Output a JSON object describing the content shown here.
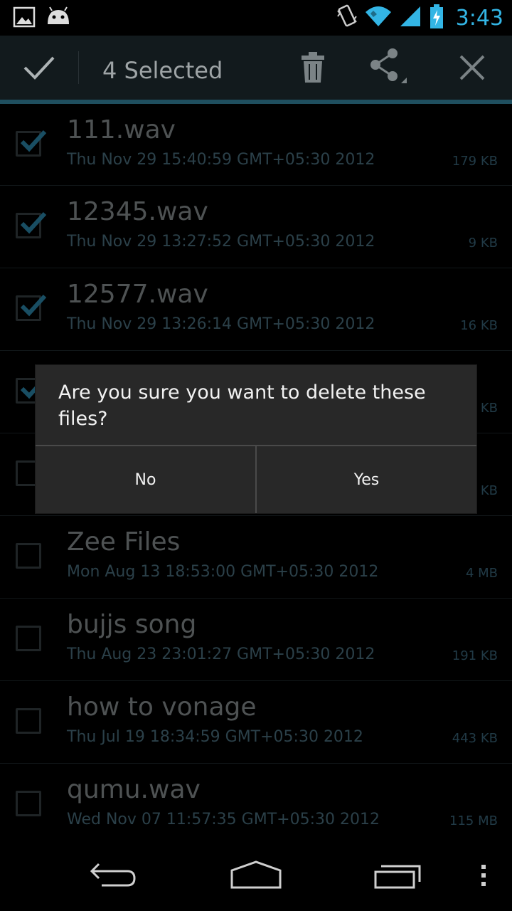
{
  "status_bar": {
    "time": "3:43",
    "icons": [
      "picture-icon",
      "android-debug-icon",
      "vibrate-icon",
      "wifi-icon",
      "signal-icon",
      "battery-charging-icon"
    ]
  },
  "action_bar": {
    "title": "4 Selected",
    "actions": [
      "done-check-icon",
      "trash-icon",
      "share-icon",
      "close-icon"
    ]
  },
  "files": [
    {
      "name": "111.wav",
      "date": "Thu Nov 29 15:40:59 GMT+05:30 2012",
      "size": "179 KB",
      "checked": true
    },
    {
      "name": "12345.wav",
      "date": "Thu Nov 29 13:27:52 GMT+05:30 2012",
      "size": "9 KB",
      "checked": true
    },
    {
      "name": "12577.wav",
      "date": "Thu Nov 29 13:26:14 GMT+05:30 2012",
      "size": "16 KB",
      "checked": true
    },
    {
      "name": "",
      "date": "",
      "size": "KB",
      "checked": true
    },
    {
      "name": "",
      "date": "",
      "size": "KB",
      "checked": false
    },
    {
      "name": "Zee Files",
      "date": "Mon Aug 13 18:53:00 GMT+05:30 2012",
      "size": "4 MB",
      "checked": false
    },
    {
      "name": "bujjs song",
      "date": "Thu Aug 23 23:01:27 GMT+05:30 2012",
      "size": "191 KB",
      "checked": false
    },
    {
      "name": "how to vonage",
      "date": "Thu Jul 19 18:34:59 GMT+05:30 2012",
      "size": "443 KB",
      "checked": false
    },
    {
      "name": "qumu.wav",
      "date": "Wed Nov 07 11:57:35 GMT+05:30 2012",
      "size": "115 MB",
      "checked": false
    }
  ],
  "dialog": {
    "message": "Are you sure you want to delete these files?",
    "no_label": "No",
    "yes_label": "Yes"
  },
  "colors": {
    "accent": "#33b5e5",
    "background": "#000000",
    "dialog_bg": "#282828"
  }
}
